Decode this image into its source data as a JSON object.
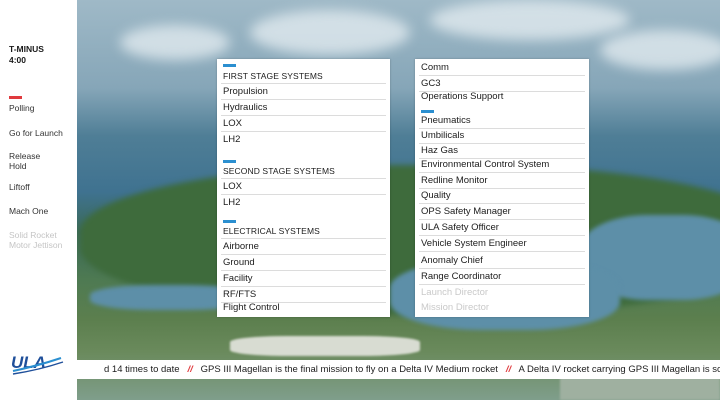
{
  "countdown": {
    "label": "T-MINUS",
    "time": "4:00"
  },
  "milestones": [
    {
      "label": "Polling",
      "active": true
    },
    {
      "label": "Go for Launch",
      "active": false
    },
    {
      "label": "Release Hold",
      "active": false
    },
    {
      "label": "Liftoff",
      "active": false
    },
    {
      "label": "Mach One",
      "active": false
    },
    {
      "label": "Solid Rocket Motor Jettison",
      "active": false
    }
  ],
  "logo": {
    "text": "ULA"
  },
  "left_panel": {
    "first_stage": {
      "title": "FIRST STAGE SYSTEMS",
      "items": [
        "Propulsion",
        "Hydraulics",
        "LOX",
        "LH2"
      ]
    },
    "second_stage": {
      "title": "SECOND STAGE SYSTEMS",
      "items": [
        "LOX",
        "LH2"
      ]
    },
    "electrical": {
      "title": "ELECTRICAL SYSTEMS",
      "items": [
        "Airborne",
        "Ground",
        "Facility",
        "RF/FTS",
        "Flight Control"
      ]
    }
  },
  "right_panel": {
    "group_1": [
      "Comm",
      "GC3",
      "Operations Support"
    ],
    "group_2": [
      "Pneumatics",
      "Umbilicals",
      "Haz Gas",
      "Environmental Control System",
      "Redline Monitor",
      "Quality",
      "OPS Safety Manager",
      "ULA Safety Officer",
      "Vehicle System Engineer",
      "Anomaly Chief",
      "Range Coordinator"
    ],
    "pending": [
      "Launch Director",
      "Mission Director"
    ]
  },
  "ticker": {
    "segment_1": "d 14 times to date",
    "separator": "//",
    "segment_2": "GPS III Magellan is the final mission to fly on a Delta IV Medium rocket",
    "segment_3": "A Delta IV rocket carrying GPS III Magellan is sch"
  },
  "colors": {
    "accent_blue": "#2b8fd0",
    "accent_red": "#e03a3e"
  }
}
